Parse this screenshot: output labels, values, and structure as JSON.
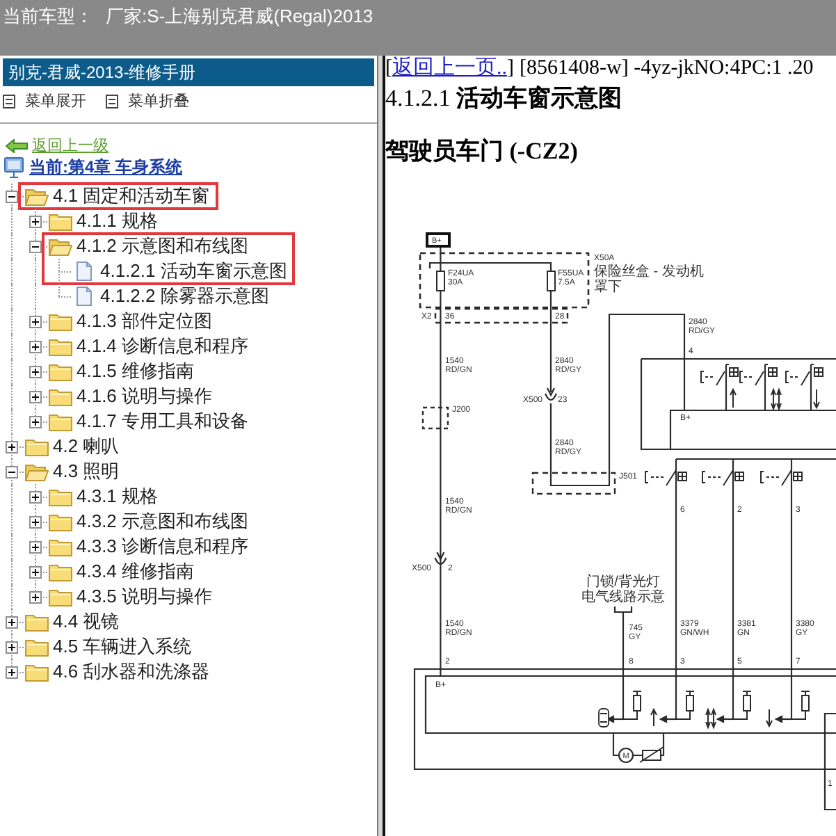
{
  "header": {
    "label": "当前车型：",
    "value": "厂家:S-上海别克君威(Regal)2013"
  },
  "sidebar": {
    "title": "别克-君威-2013-维修手册",
    "toolbar": [
      {
        "label": "菜单展开"
      },
      {
        "label": "菜单折叠"
      }
    ],
    "back_link": "返回上一级",
    "current_chapter": "当前:第4章 车身系统",
    "tree": [
      {
        "label": "4.1 固定和活动车窗",
        "kind": "folder",
        "expanded": true,
        "highlighted": true,
        "children": [
          {
            "label": "4.1.1 规格",
            "kind": "folder",
            "expanded": false,
            "highlighted": false
          },
          {
            "label": "4.1.2 示意图和布线图",
            "kind": "folder",
            "expanded": true,
            "highlighted": true,
            "children": [
              {
                "label": "4.1.2.1 活动车窗示意图",
                "kind": "page",
                "highlighted": true
              },
              {
                "label": "4.1.2.2 除雾器示意图",
                "kind": "page",
                "highlighted": false
              }
            ]
          },
          {
            "label": "4.1.3 部件定位图",
            "kind": "folder",
            "expanded": false,
            "highlighted": false
          },
          {
            "label": "4.1.4 诊断信息和程序",
            "kind": "folder",
            "expanded": false,
            "highlighted": false
          },
          {
            "label": "4.1.5 维修指南",
            "kind": "folder",
            "expanded": false,
            "highlighted": false
          },
          {
            "label": "4.1.6 说明与操作",
            "kind": "folder",
            "expanded": false,
            "highlighted": false
          },
          {
            "label": "4.1.7 专用工具和设备",
            "kind": "folder",
            "expanded": false,
            "highlighted": false
          }
        ]
      },
      {
        "label": "4.2 喇叭",
        "kind": "folder",
        "expanded": false,
        "highlighted": false
      },
      {
        "label": "4.3 照明",
        "kind": "folder",
        "expanded": true,
        "highlighted": false,
        "children": [
          {
            "label": "4.3.1 规格",
            "kind": "folder",
            "expanded": false,
            "highlighted": false
          },
          {
            "label": "4.3.2 示意图和布线图",
            "kind": "folder",
            "expanded": false,
            "highlighted": false
          },
          {
            "label": "4.3.3 诊断信息和程序",
            "kind": "folder",
            "expanded": false,
            "highlighted": false
          },
          {
            "label": "4.3.4 维修指南",
            "kind": "folder",
            "expanded": false,
            "highlighted": false
          },
          {
            "label": "4.3.5 说明与操作",
            "kind": "folder",
            "expanded": false,
            "highlighted": false
          }
        ]
      },
      {
        "label": "4.4 视镜",
        "kind": "folder",
        "expanded": false,
        "highlighted": false
      },
      {
        "label": "4.5 车辆进入系统",
        "kind": "folder",
        "expanded": false,
        "highlighted": false
      },
      {
        "label": "4.6 刮水器和洗涤器",
        "kind": "folder",
        "expanded": false,
        "highlighted": false
      }
    ]
  },
  "content": {
    "back_link": {
      "before": "[",
      "label": "返回上一页..",
      "after": "]"
    },
    "doc_info": "[8561408-w] -4yz-jkNO:4PC:1 .20",
    "title": "4.1.2.1 **活动车窗示意图**",
    "subtitle": "驾驶员车门 (-CZ2)",
    "diagram": {
      "labels": [
        {
          "lines": [
            "B+"
          ]
        },
        {
          "lines": [
            "F24UA",
            "30A"
          ]
        },
        {
          "lines": [
            "F55UA",
            "7.5A"
          ]
        },
        {
          "lines": [
            "X50A"
          ]
        },
        {
          "lines": [
            "保险丝盒 - 发动机",
            "罩下"
          ]
        },
        {
          "lines": [
            "X2"
          ]
        },
        {
          "lines": [
            "36"
          ]
        },
        {
          "lines": [
            "28"
          ]
        },
        {
          "lines": [
            "2840",
            "RD/GY"
          ]
        },
        {
          "lines": [
            "4"
          ]
        },
        {
          "lines": [
            "1540",
            "RD/GN"
          ]
        },
        {
          "lines": [
            "2840",
            "RD/GY"
          ]
        },
        {
          "lines": [
            "X500"
          ]
        },
        {
          "lines": [
            "23"
          ]
        },
        {
          "lines": [
            "J200"
          ]
        },
        {
          "lines": [
            "B+"
          ]
        },
        {
          "lines": [
            "2840",
            "RD/GY"
          ]
        },
        {
          "lines": [
            "J501"
          ]
        },
        {
          "lines": [
            "1540",
            "RD/GN"
          ]
        },
        {
          "lines": [
            "6"
          ]
        },
        {
          "lines": [
            "2"
          ]
        },
        {
          "lines": [
            "3"
          ]
        },
        {
          "lines": [
            "X500"
          ]
        },
        {
          "lines": [
            "2"
          ]
        },
        {
          "lines": [
            "门锁/背光灯",
            "电气线路示意"
          ]
        },
        {
          "lines": [
            "1540",
            "RD/GN"
          ]
        },
        {
          "lines": [
            "745",
            "GY"
          ]
        },
        {
          "lines": [
            "3379",
            "GN/WH"
          ]
        },
        {
          "lines": [
            "3381",
            "GN"
          ]
        },
        {
          "lines": [
            "3380",
            "GY"
          ]
        },
        {
          "lines": [
            "2"
          ]
        },
        {
          "lines": [
            "8"
          ]
        },
        {
          "lines": [
            "3"
          ]
        },
        {
          "lines": [
            "5"
          ]
        },
        {
          "lines": [
            "7"
          ]
        },
        {
          "lines": [
            "B+"
          ]
        },
        {
          "lines": [
            "M"
          ]
        },
        {
          "lines": [
            "1"
          ]
        }
      ]
    }
  }
}
